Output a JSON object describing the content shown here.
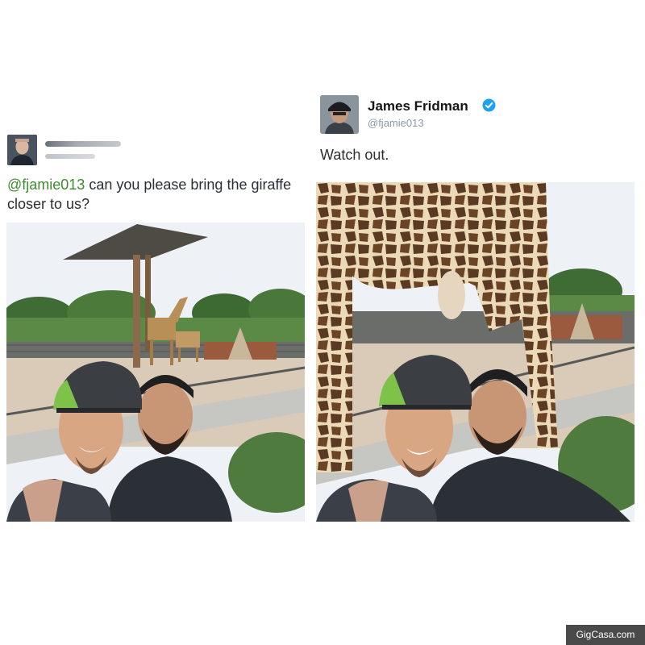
{
  "left_tweet": {
    "mention": "@fjamie013",
    "text": " can you please bring the giraffe closer to us?",
    "avatar_icon": "user-avatar",
    "mention_color": "#3d8c2d"
  },
  "right_tweet": {
    "name": "James Fridman",
    "handle": "@fjamie013",
    "text": "Watch out.",
    "verified_icon": "verified-badge-icon",
    "verified_color": "#1da1f2"
  },
  "watermark": {
    "text": "GigCasa.com"
  }
}
